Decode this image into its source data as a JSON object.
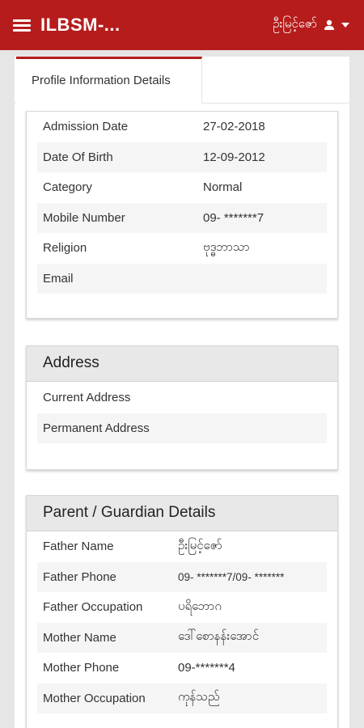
{
  "header": {
    "title": "ILBSM-...",
    "user_name": "ဦးမြင့်ဇော်"
  },
  "tabs": {
    "active_label": "Profile Information Details"
  },
  "profile": {
    "rows": [
      {
        "label": "Admission Date",
        "value": "27-02-2018"
      },
      {
        "label": "Date Of Birth",
        "value": "12-09-2012"
      },
      {
        "label": "Category",
        "value": "Normal"
      },
      {
        "label": "Mobile Number",
        "value": "09- *******7"
      },
      {
        "label": "Religion",
        "value": "ဗုဒ္ဓဘာသာ"
      },
      {
        "label": "Email",
        "value": ""
      }
    ]
  },
  "address": {
    "title": "Address",
    "rows": [
      {
        "label": "Current Address",
        "value": ""
      },
      {
        "label": "Permanent Address",
        "value": ""
      }
    ]
  },
  "guardian": {
    "title": "Parent / Guardian Details",
    "rows": [
      {
        "label": "Father Name",
        "value": "ဦးမြင့်ဇော်"
      },
      {
        "label": "Father Phone",
        "value": "09- *******7/09- *******"
      },
      {
        "label": "Father Occupation",
        "value": "ပရိဘောဂ"
      },
      {
        "label": "Mother Name",
        "value": "ဒေါ်စောနန်းအောင်"
      },
      {
        "label": "Mother Phone",
        "value": "09-*******4"
      },
      {
        "label": "Mother Occupation",
        "value": "ကုန်သည်"
      }
    ]
  },
  "colors": {
    "brand_red": "#b71c1c",
    "page_bg": "#e6e6e6",
    "card_header_bg": "#e8e8e8",
    "stripe": "#f5f5f5"
  },
  "icons": [
    "menu-icon",
    "user-icon",
    "caret-down-icon"
  ]
}
